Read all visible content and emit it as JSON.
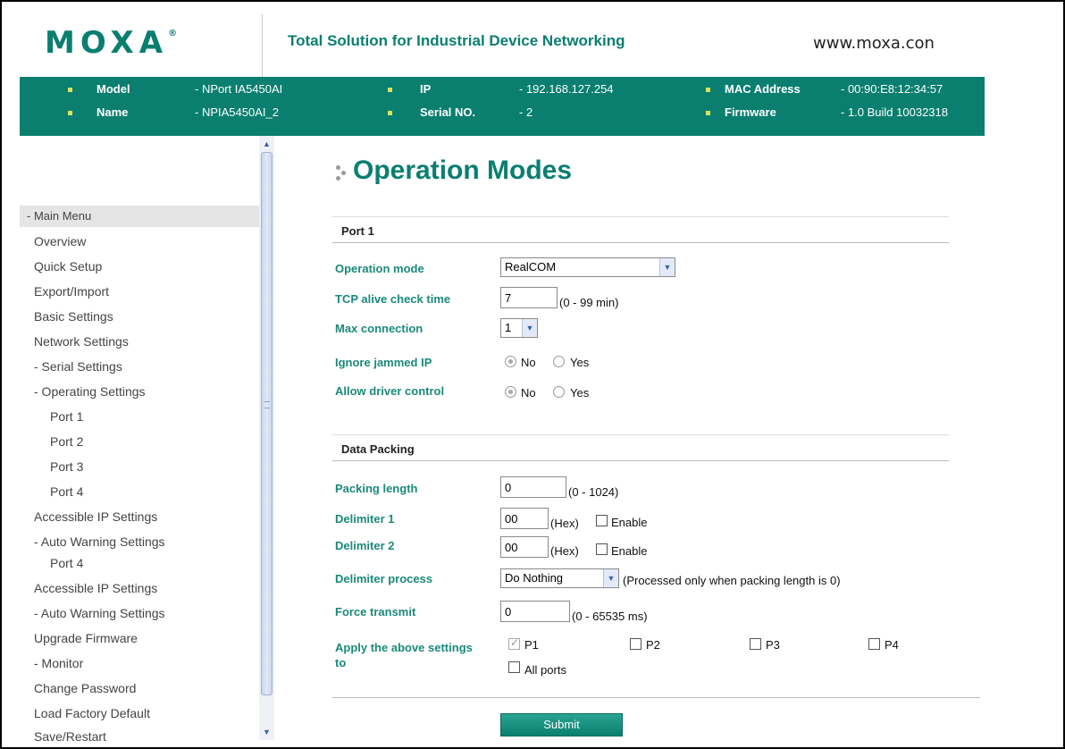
{
  "header": {
    "logo": "MOXA",
    "logo_mark": "®",
    "tagline": "Total Solution for Industrial Device Networking",
    "website": "www.moxa.con"
  },
  "info": {
    "model_label": "Model",
    "model_value": "- NPort IA5450AI",
    "name_label": "Name",
    "name_value": "- NPIA5450AI_2",
    "ip_label": "IP",
    "ip_value": "- 192.168.127.254",
    "serial_label": "Serial NO.",
    "serial_value": "- 2",
    "mac_label": "MAC Address",
    "mac_value": "- 00:90:E8:12:34:57",
    "firmware_label": "Firmware",
    "firmware_value": "- 1.0 Build 10032318"
  },
  "sidebar": {
    "head": "- Main Menu",
    "items": [
      "Overview",
      "Quick Setup",
      "Export/Import",
      "Basic Settings",
      "Network Settings",
      "- Serial Settings",
      "- Operating Settings",
      "Port 1",
      "Port 2",
      "Port 3",
      "Port 4",
      "Accessible IP Settings",
      "- Auto Warning Settings",
      "Port 4",
      "Accessible IP Settings",
      "- Auto Warning Settings",
      "Upgrade Firmware",
      "- Monitor",
      "Change Password",
      "Load Factory Default",
      "Save/Restart"
    ]
  },
  "scrollbar": {
    "up_icon": "▲",
    "down_icon": "▼"
  },
  "main": {
    "title": "Operation Modes",
    "port_section": "Port 1",
    "operation_mode_label": "Operation mode",
    "operation_mode_value": "RealCOM",
    "tcp_alive_label": "TCP alive check time",
    "tcp_alive_value": "7",
    "tcp_alive_hint": "(0 - 99 min)",
    "max_conn_label": "Max connection",
    "max_conn_value": "1",
    "ignore_ip_label": "Ignore jammed IP",
    "allow_driver_label": "Allow driver control",
    "no_label": "No",
    "yes_label": "Yes",
    "data_packing_section": "Data Packing",
    "packing_length_label": "Packing length",
    "packing_length_value": "0",
    "packing_length_hint": "(0 - 1024)",
    "delim1_label": "Delimiter 1",
    "delim1_value": "00",
    "delim2_label": "Delimiter 2",
    "delim2_value": "00",
    "hex_label": "(Hex)",
    "enable_label": "Enable",
    "delim_process_label": "Delimiter process",
    "delim_process_value": "Do Nothing",
    "delim_process_hint": "(Processed only when packing length is 0)",
    "force_transmit_label": "Force transmit",
    "force_transmit_value": "0",
    "force_transmit_hint": "(0 - 65535 ms)",
    "apply_label_1": "Apply the above settings",
    "apply_label_2": "to",
    "p1": "P1",
    "p2": "P2",
    "p3": "P3",
    "p4": "P4",
    "all_ports": "All ports",
    "submit": "Submit",
    "dropdown_icon": "▼"
  }
}
